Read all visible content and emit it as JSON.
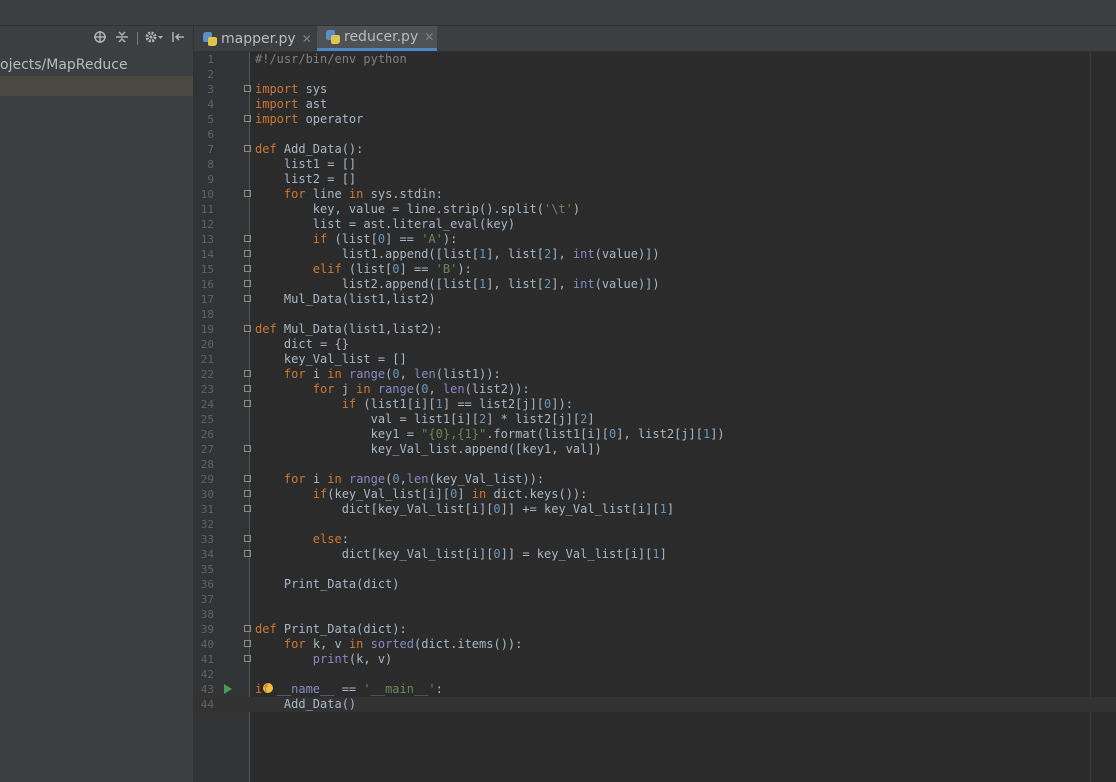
{
  "topbar": {
    "glyph": "/"
  },
  "sidebar": {
    "project_path": "ojects/MapReduce",
    "toolbar_icons": [
      "crosshair-icon",
      "collapse-icon",
      "settings-icon",
      "hide-icon"
    ]
  },
  "tabs": [
    {
      "label": "mapper.py",
      "active": false
    },
    {
      "label": "reducer.py",
      "active": true
    }
  ],
  "editor": {
    "current_line": 44,
    "lines": [
      "#!/usr/bin/env python",
      "",
      "import sys",
      "import ast",
      "import operator",
      "",
      "def Add_Data():",
      "    list1 = []",
      "    list2 = []",
      "    for line in sys.stdin:",
      "        key, value = line.strip().split('\\t')",
      "        list = ast.literal_eval(key)",
      "        if (list[0] == 'A'):",
      "            list1.append([list[1], list[2], int(value)])",
      "        elif (list[0] == 'B'):",
      "            list2.append([list[1], list[2], int(value)])",
      "    Mul_Data(list1,list2)",
      "",
      "def Mul_Data(list1,list2):",
      "    dict = {}",
      "    key_Val_list = []",
      "    for i in range(0, len(list1)):",
      "        for j in range(0, len(list2)):",
      "            if (list1[i][1] == list2[j][0]):",
      "                val = list1[i][2] * list2[j][2]",
      "                key1 = \"{0},{1}\".format(list1[i][0], list2[j][1])",
      "                key_Val_list.append([key1, val])",
      "",
      "    for i in range(0,len(key_Val_list)):",
      "        if(key_Val_list[i][0] in dict.keys()):",
      "            dict[key_Val_list[i][0]] += key_Val_list[i][1]",
      "",
      "        else:",
      "            dict[key_Val_list[i][0]] = key_Val_list[i][1]",
      "",
      "    Print_Data(dict)",
      "",
      "",
      "def Print_Data(dict):",
      "    for k, v in sorted(dict.items()):",
      "        print(k, v)",
      "",
      "if __name__ == '__main__':",
      "    Add_Data()"
    ]
  }
}
